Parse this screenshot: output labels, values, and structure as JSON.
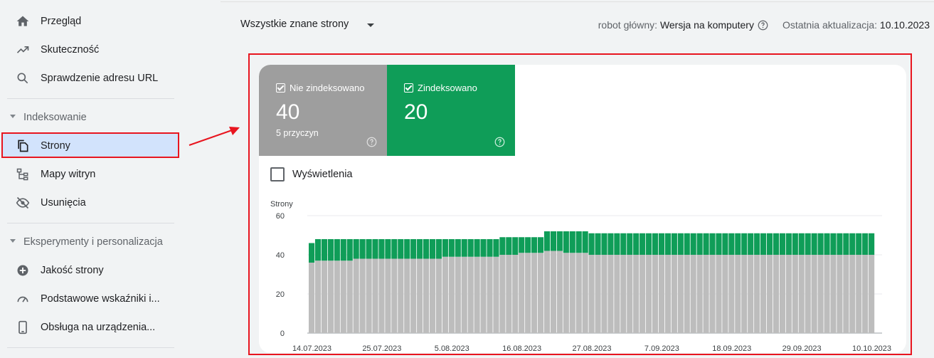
{
  "sidebar": {
    "items": [
      {
        "label": "Przegląd",
        "icon": "home-icon"
      },
      {
        "label": "Skuteczność",
        "icon": "trending-up-icon"
      },
      {
        "label": "Sprawdzenie adresu URL",
        "icon": "search-icon"
      },
      {
        "label": "Strony",
        "icon": "pages-icon"
      },
      {
        "label": "Mapy witryn",
        "icon": "sitemap-icon"
      },
      {
        "label": "Usunięcia",
        "icon": "eye-off-icon"
      },
      {
        "label": "Jakość strony",
        "icon": "plus-circle-icon"
      },
      {
        "label": "Podstawowe wskaźniki i...",
        "icon": "gauge-icon"
      },
      {
        "label": "Obsługa na urządzenia...",
        "icon": "phone-icon"
      }
    ],
    "sections": [
      "Indeksowanie",
      "Eksperymenty i personalizacja"
    ],
    "active_item": "Strony"
  },
  "header": {
    "filter_label": "Wszystkie znane strony",
    "crawler_label": "robot główny:",
    "crawler_value": "Wersja na komputery",
    "update_label": "Ostatnia aktualizacja:",
    "update_value": "10.10.2023"
  },
  "tiles": {
    "not_indexed": {
      "label": "Nie zindeksowano",
      "value": "40",
      "sub": "5 przyczyn"
    },
    "indexed": {
      "label": "Zindeksowano",
      "value": "20"
    }
  },
  "views_checkbox": {
    "label": "Wyświetlenia",
    "checked": false
  },
  "colors": {
    "not_indexed": "#bdbdbd",
    "indexed": "#0f9d58",
    "tile_gray": "#9e9e9e",
    "highlight": "#e8151f",
    "active_bg": "#d2e3fc"
  },
  "chart_data": {
    "type": "bar",
    "stacked": true,
    "ylabel": "Strony",
    "ylim": [
      0,
      60
    ],
    "yticks": [
      0,
      20,
      40,
      60
    ],
    "x_tick_labels": [
      "14.07.2023",
      "25.07.2023",
      "5.08.2023",
      "16.08.2023",
      "27.08.2023",
      "7.09.2023",
      "18.09.2023",
      "29.09.2023",
      "10.10.2023"
    ],
    "x_tick_positions": [
      0,
      11,
      22,
      33,
      44,
      55,
      66,
      77,
      88
    ],
    "series": [
      {
        "name": "Nie zindeksowano",
        "color": "#bdbdbd",
        "values": [
          36,
          37,
          37,
          37,
          37,
          37,
          37,
          38,
          38,
          38,
          38,
          38,
          38,
          38,
          38,
          38,
          38,
          38,
          38,
          38,
          38,
          39,
          39,
          39,
          39,
          39,
          39,
          39,
          39,
          39,
          40,
          40,
          40,
          41,
          41,
          41,
          41,
          42,
          42,
          42,
          41,
          41,
          41,
          41,
          40,
          40,
          40,
          40,
          40,
          40,
          40,
          40,
          40,
          40,
          40,
          40,
          40,
          40,
          40,
          40,
          40,
          40,
          40,
          40,
          40,
          40,
          40,
          40,
          40,
          40,
          40,
          40,
          40,
          40,
          40,
          40,
          40,
          40,
          40,
          40,
          40,
          40,
          40,
          40,
          40,
          40,
          40,
          40,
          40
        ]
      },
      {
        "name": "Zindeksowano",
        "color": "#0f9d58",
        "values": [
          10,
          11,
          11,
          11,
          11,
          11,
          11,
          10,
          10,
          10,
          10,
          10,
          10,
          10,
          10,
          10,
          10,
          10,
          10,
          10,
          10,
          9,
          9,
          9,
          9,
          9,
          9,
          9,
          9,
          9,
          9,
          9,
          9,
          8,
          8,
          8,
          8,
          10,
          10,
          10,
          11,
          11,
          11,
          11,
          11,
          11,
          11,
          11,
          11,
          11,
          11,
          11,
          11,
          11,
          11,
          11,
          11,
          11,
          11,
          11,
          11,
          11,
          11,
          11,
          11,
          11,
          11,
          11,
          11,
          11,
          11,
          11,
          11,
          11,
          11,
          11,
          11,
          11,
          11,
          11,
          11,
          11,
          11,
          11,
          11,
          11,
          11,
          11,
          11
        ]
      }
    ]
  }
}
